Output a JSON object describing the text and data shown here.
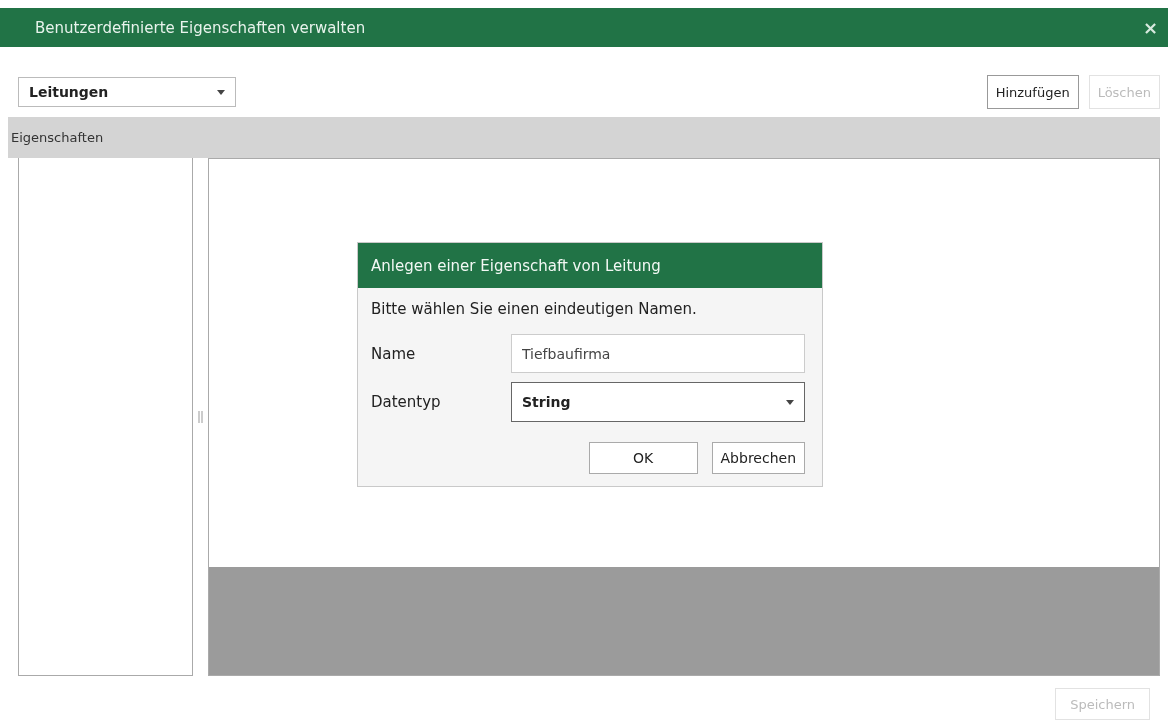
{
  "window": {
    "title": "Benutzerdefinierte Eigenschaften verwalten",
    "close": "×"
  },
  "toolbar": {
    "object_select": {
      "value": "Leitungen"
    },
    "buttons": [
      {
        "label": "Hinzufügen",
        "disabled": false
      },
      {
        "label": "Löschen",
        "disabled": true
      }
    ]
  },
  "properties_header": "Eigenschaften",
  "dialog": {
    "title": "Anlegen einer Eigenschaft von Leitung",
    "message": "Bitte wählen Sie einen eindeutigen Namen.",
    "fields": [
      {
        "kind": "text",
        "label": "Name",
        "value": "Tiefbaufirma"
      },
      {
        "kind": "select",
        "label": "Datentyp",
        "value": "String"
      }
    ],
    "buttons": [
      {
        "label": "OK",
        "disabled": false
      },
      {
        "label": "Abbrechen",
        "disabled": false
      }
    ]
  },
  "footer": {
    "buttons": [
      {
        "label": "Speichern",
        "disabled": true
      }
    ]
  }
}
